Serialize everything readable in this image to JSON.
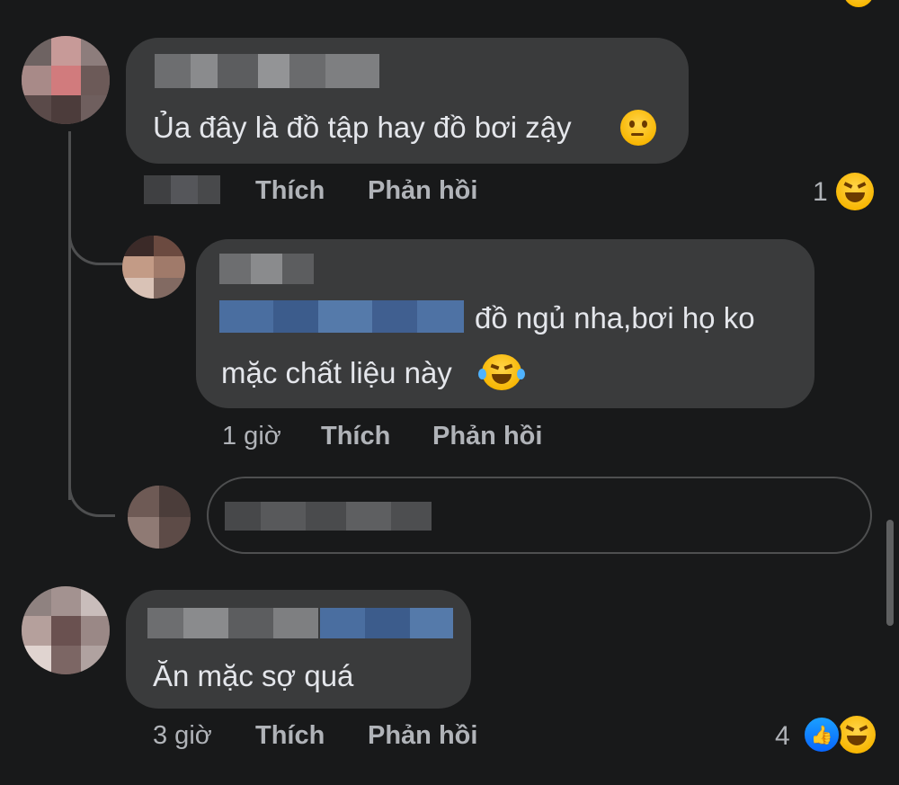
{
  "comments": [
    {
      "text": "Ủa đây là đồ tập hay đồ bơi zậy",
      "emoji": "thinking-face",
      "like_label": "Thích",
      "reply_label": "Phản hồi",
      "reaction_count": "1",
      "reaction_icon": "laughing-face"
    },
    {
      "text_line1": "đồ ngủ nha,bơi họ ko",
      "text_line2": "mặc chất liệu này",
      "emoji": "tears-of-joy-face",
      "time": "1 giờ",
      "like_label": "Thích",
      "reply_label": "Phản hồi"
    },
    {
      "text": "Ăn mặc sợ quá",
      "time": "3 giờ",
      "like_label": "Thích",
      "reply_label": "Phản hồi",
      "reaction_count": "4",
      "reaction_icons": [
        "like-icon",
        "laughing-face"
      ]
    }
  ],
  "colors": {
    "background": "#18191a",
    "bubble": "#3a3b3c",
    "text": "#e4e6eb",
    "meta": "#b0b3b8",
    "like_blue": "#0866ff"
  }
}
